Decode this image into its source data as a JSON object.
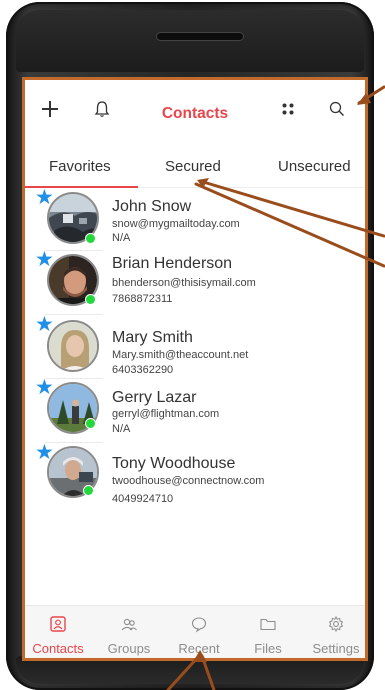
{
  "header": {
    "title": "Contacts",
    "add_icon": "plus-icon",
    "bell_icon": "bell-icon",
    "grid_icon": "grid-icon",
    "search_icon": "search-icon"
  },
  "tabs": [
    {
      "label": "Favorites",
      "active": true
    },
    {
      "label": "Secured",
      "active": false
    },
    {
      "label": "Unsecured",
      "active": false
    }
  ],
  "contacts": [
    {
      "name": "John Snow",
      "email": "snow@mygmailtoday.com",
      "phone": "N/A",
      "favorite": true,
      "online": true
    },
    {
      "name": "Brian Henderson",
      "email": "bhenderson@thisisymail.com",
      "phone": "7868872311",
      "favorite": true,
      "online": true
    },
    {
      "name": "Mary Smith",
      "email": "Mary.smith@theaccount.net",
      "phone": "6403362290",
      "favorite": true,
      "online": false
    },
    {
      "name": "Gerry Lazar",
      "email": "gerryl@flightman.com",
      "phone": "N/A",
      "favorite": true,
      "online": true
    },
    {
      "name": "Tony Woodhouse",
      "email": "twoodhouse@connectnow.com",
      "phone": "4049924710",
      "favorite": true,
      "online": true
    }
  ],
  "bottom_nav": [
    {
      "label": "Contacts",
      "icon": "contacts-icon",
      "active": true
    },
    {
      "label": "Groups",
      "icon": "groups-icon",
      "active": false
    },
    {
      "label": "Recent",
      "icon": "chat-bubble-icon",
      "active": false
    },
    {
      "label": "Files",
      "icon": "folder-icon",
      "active": false
    },
    {
      "label": "Settings",
      "icon": "gear-icon",
      "active": false
    }
  ],
  "colors": {
    "accent": "#e8464b",
    "star": "#1e90e8",
    "online": "#22d83a",
    "annotation": "#9a4d1c",
    "screen_border": "#c16a2c"
  }
}
